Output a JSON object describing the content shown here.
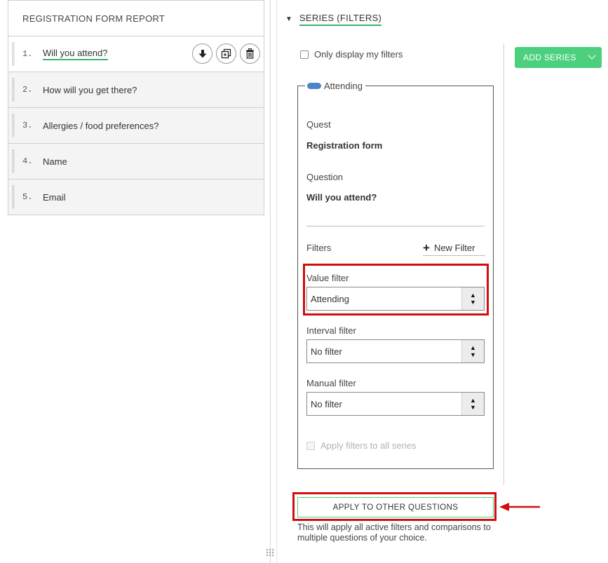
{
  "report": {
    "title": "REGISTRATION FORM REPORT",
    "questions": [
      {
        "num": "1.",
        "label": "Will you attend?"
      },
      {
        "num": "2.",
        "label": "How will you get there?"
      },
      {
        "num": "3.",
        "label": "Allergies / food preferences?"
      },
      {
        "num": "4.",
        "label": "Name"
      },
      {
        "num": "5.",
        "label": "Email"
      }
    ],
    "item_actions": [
      "download-icon",
      "duplicate-icon",
      "trash-icon"
    ]
  },
  "series": {
    "title": "SERIES (FILTERS)",
    "only_mine_label": "Only display my filters",
    "add_series_label": "ADD SERIES",
    "legend": "Attending",
    "quest_label": "Quest",
    "quest_value": "Registration form",
    "question_label": "Question",
    "question_value": "Will you attend?",
    "filters_label": "Filters",
    "new_filter_label": "New Filter",
    "value_filter_label": "Value filter",
    "value_filter_value": "Attending",
    "interval_filter_label": "Interval filter",
    "interval_filter_value": "No filter",
    "manual_filter_label": "Manual filter",
    "manual_filter_value": "No filter",
    "apply_all_label": "Apply filters to all series",
    "apply_btn_label": "APPLY TO OTHER QUESTIONS",
    "help_text": "This will apply all active filters and comparisons to multiple questions of your choice."
  },
  "colors": {
    "accent_green": "#4cd07d",
    "underline_green": "#3cb371",
    "highlight_red": "#d10f0f",
    "legend_blue": "#4a86c8"
  }
}
